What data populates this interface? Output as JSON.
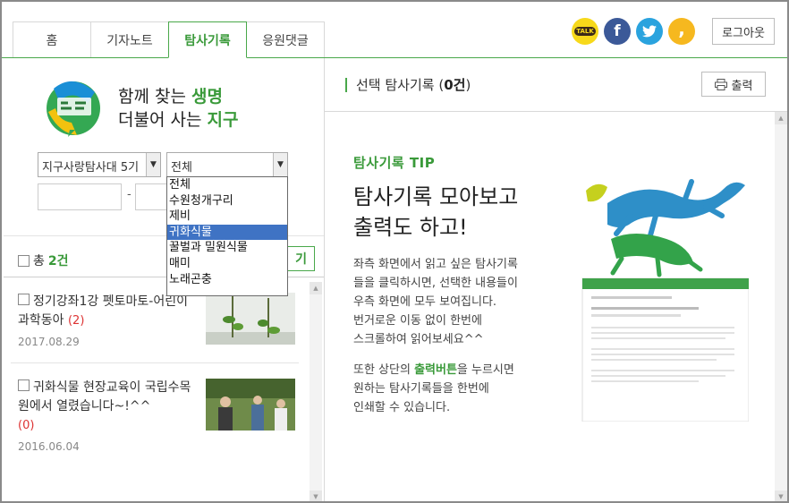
{
  "tabs": [
    {
      "label": "홈"
    },
    {
      "label": "기자노트"
    },
    {
      "label": "탐사기록"
    },
    {
      "label": "응원댓글"
    }
  ],
  "social": {
    "talk": "TALK",
    "facebook": "f",
    "twitter": "t",
    "story": ","
  },
  "logout_label": "로그아웃",
  "slogan": {
    "line1_a": "함께 찾는 ",
    "line1_b": "생명",
    "line2_a": "더불어 사는 ",
    "line2_b": "지구"
  },
  "filters": {
    "group_value": "지구사랑탐사대 5기",
    "category_value": "전체"
  },
  "date_separator": "-",
  "category_options": [
    "전체",
    "수원청개구리",
    "제비",
    "귀화식물",
    "꿀벌과 밀원식물",
    "매미",
    "노래곤충"
  ],
  "category_selected_index": 3,
  "list": {
    "total_label": "총",
    "total_count": "2건",
    "add_button_label": "기",
    "items": [
      {
        "title": "정기강좌1강 펫토마토-어린이과학동아",
        "count": "(2)",
        "date": "2017.08.29"
      },
      {
        "title": "귀화식물 현장교육이 국립수목원에서 열렸습니다~!^^",
        "count": "(0)",
        "date": "2016.06.04"
      }
    ]
  },
  "right": {
    "title_prefix": "선택 탐사기록 (",
    "title_count": "0건",
    "title_suffix": ")",
    "print_label": "출력",
    "tip_label": "탐사기록 TIP",
    "tip_head_1": "탐사기록 모아보고",
    "tip_head_2": "출력도 하고!",
    "tip_p1": [
      "좌측 화면에서 읽고 싶은 탐사기록",
      "들을 클릭하시면, 선택한 내용들이",
      "우측 화면에 모두 보여집니다.",
      "번거로운 이동 없이 한번에",
      "스크롤하여 읽어보세요^^"
    ],
    "tip_p2_a": "또한 상단의 ",
    "tip_p2_hl": "출력버튼",
    "tip_p2_b": "을 누르시면",
    "tip_p2_2": "원하는 탐사기록들을 한번에",
    "tip_p2_3": "인쇄할 수 있습니다."
  },
  "colors": {
    "accent": "#49a84a",
    "accent_text": "#3a9a3a",
    "count_red": "#d33333",
    "dropdown_highlight": "#3f73c4"
  }
}
